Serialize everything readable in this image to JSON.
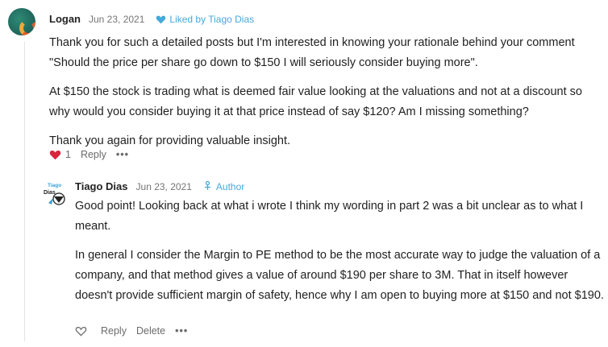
{
  "comments": [
    {
      "author": "Logan",
      "date": "Jun 23, 2021",
      "liked_by": "Liked by Tiago Dias",
      "paragraphs": [
        "Thank you for such a detailed posts but I'm interested in knowing your rationale behind your comment \"Should the price per share go down to $150 I will seriously consider buying more\".",
        "At $150 the stock is trading what is deemed fair value looking at the valuations and not at a discount so why would you consider buying it at that price instead of say $120? Am I missing something?",
        "Thank you again for providing valuable insight."
      ],
      "like_count": "1",
      "reply_label": "Reply",
      "more_label": "•••"
    },
    {
      "author": "Tiago Dias",
      "date": "Jun 23, 2021",
      "badge": "Author",
      "avatar_text": "Tiago Dias",
      "paragraphs": [
        "Good point! Looking back at what i wrote I think my wording in part 2 was a bit unclear as to what I meant.",
        "In general I consider the Margin to PE method to be the most accurate way to judge the valuation of a company, and that method gives a value of around $190 per share to 3M. That in itself however doesn't provide sufficient margin of safety, hence why I am open to buying more at $150 and not $190."
      ],
      "reply_label": "Reply",
      "delete_label": "Delete",
      "more_label": "•••"
    }
  ],
  "colors": {
    "accent": "#45a9db",
    "heart": "#d7263d",
    "muted": "#757575"
  }
}
